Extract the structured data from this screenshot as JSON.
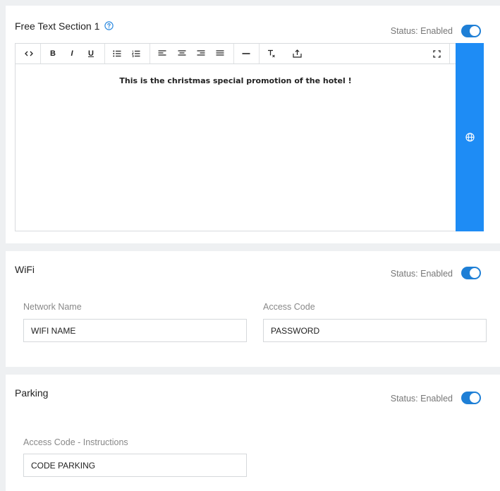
{
  "free_text": {
    "title": "Free Text Section 1",
    "status": "Status: Enabled",
    "toolbar": {
      "bold": "B",
      "italic": "I",
      "underline": "U"
    },
    "content": "This is the christmas special promotion of the hotel !"
  },
  "wifi": {
    "title": "WiFi",
    "status": "Status: Enabled",
    "network_name_label": "Network Name",
    "network_name_value": "WIFI NAME",
    "access_code_label": "Access Code",
    "access_code_value": "PASSWORD"
  },
  "parking": {
    "title": "Parking",
    "status": "Status: Enabled",
    "instructions_label": "Access Code - Instructions",
    "instructions_value": "CODE PARKING"
  },
  "colors": {
    "accent": "#1e8cf5",
    "toggle": "#1e7fd6",
    "help": "#2f8be0"
  }
}
